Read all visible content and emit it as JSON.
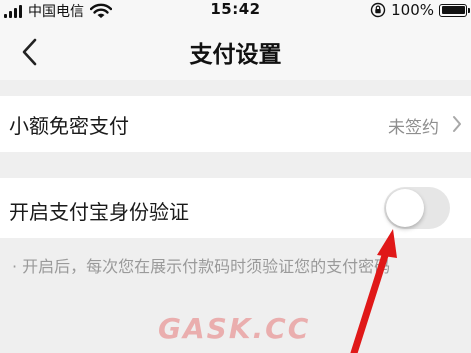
{
  "status_bar": {
    "carrier": "中国电信",
    "time": "15:42",
    "battery_percent": "100%",
    "battery_level": 1.0,
    "icons": [
      "signal-icon",
      "wifi-icon",
      "rotation-lock-icon",
      "battery-icon"
    ]
  },
  "nav": {
    "title": "支付设置",
    "back_icon": "chevron-left-icon"
  },
  "settings": {
    "small_amount_pay": {
      "label": "小额免密支付",
      "value": "未签约",
      "icon": "chevron-right-icon"
    },
    "alipay_verification": {
      "label": "开启支付宝身份验证",
      "enabled": false
    },
    "note": "· 开启后，每次您在展示付款码时须验证您的支付密码"
  },
  "watermark": "GASK.CC",
  "colors": {
    "background": "#efefef",
    "row_background": "#ffffff",
    "secondary_text": "#8e8e8e",
    "toggle_off": "#e6e6e6",
    "annotation_arrow": "#e01818"
  }
}
